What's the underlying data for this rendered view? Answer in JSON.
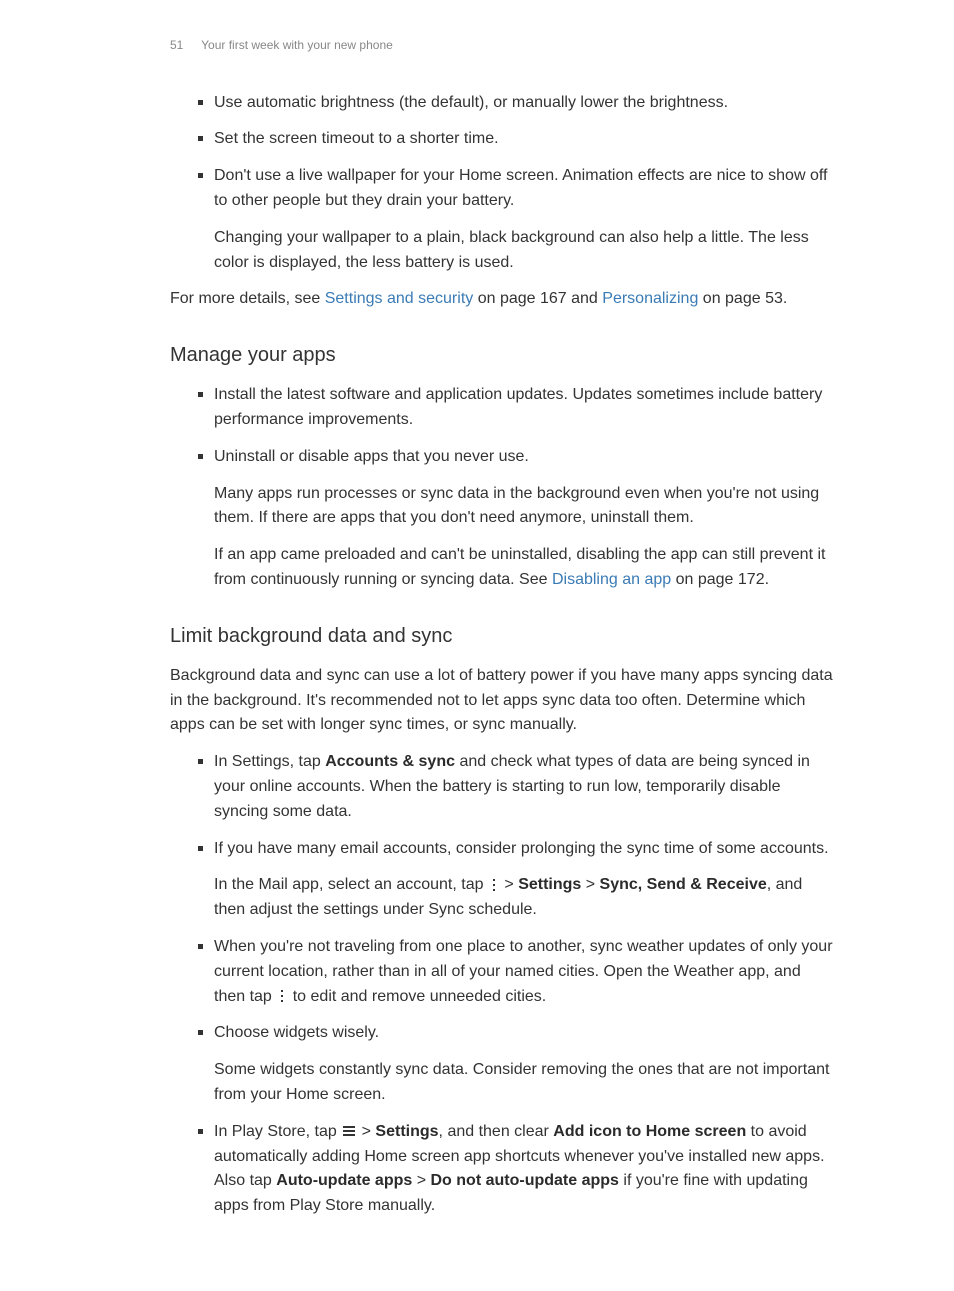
{
  "header": {
    "page_number": "51",
    "breadcrumb": "Your first week with your new phone"
  },
  "section1": {
    "b1": "Use automatic brightness (the default), or manually lower the brightness.",
    "b2": "Set the screen timeout to a shorter time.",
    "b3": "Don't use a live wallpaper for your Home screen. Animation effects are nice to show off to other people but they drain your battery.",
    "b3_sub": "Changing your wallpaper to a plain, black background can also help a little. The less color is displayed, the less battery is used.",
    "footer_pre": "For more details, see ",
    "footer_link1": "Settings and security",
    "footer_mid": " on page 167 and ",
    "footer_link2": "Personalizing",
    "footer_post": " on page 53."
  },
  "section2": {
    "title": "Manage your apps",
    "b1": "Install the latest software and application updates. Updates sometimes include battery performance improvements.",
    "b2": "Uninstall or disable apps that you never use.",
    "b2_sub1": "Many apps run processes or sync data in the background even when you're not using them. If there are apps that you don't need anymore, uninstall them.",
    "b2_sub2_pre": "If an app came preloaded and can't be uninstalled, disabling the app can still prevent it from continuously running or syncing data. See ",
    "b2_sub2_link": "Disabling an app",
    "b2_sub2_post": " on page 172."
  },
  "section3": {
    "title": "Limit background data and sync",
    "intro": "Background data and sync can use a lot of battery power if you have many apps syncing data in the background. It's recommended not to let apps sync data too often. Determine which apps can be set with longer sync times, or sync manually.",
    "b1_pre": "In Settings, tap ",
    "b1_bold": "Accounts & sync",
    "b1_post": " and check what types of data are being synced in your online accounts. When the battery is starting to run low, temporarily disable syncing some data.",
    "b2": "If you have many email accounts, consider prolonging the sync time of some accounts.",
    "b2_sub_pre": "In the Mail app, select an account, tap ",
    "b2_sub_mid1": " > ",
    "b2_sub_bold1": "Settings",
    "b2_sub_mid2": " > ",
    "b2_sub_bold2": "Sync, Send & Receive",
    "b2_sub_post": ", and then adjust the settings under Sync schedule.",
    "b3_pre": "When you're not traveling from one place to another, sync weather updates of only your current location, rather than in all of your named cities. Open the Weather app, and then tap ",
    "b3_post": " to edit and remove unneeded cities.",
    "b4": "Choose widgets wisely.",
    "b4_sub": "Some widgets constantly sync data. Consider removing the ones that are not important from your Home screen.",
    "b5_pre": "In Play Store, tap ",
    "b5_mid1": "  > ",
    "b5_bold1": "Settings",
    "b5_mid2": ", and then clear ",
    "b5_bold2": "Add icon to Home screen",
    "b5_mid3": " to avoid automatically adding Home screen app shortcuts whenever you've installed new apps. Also tap ",
    "b5_bold3": "Auto-update apps",
    "b5_mid4": " > ",
    "b5_bold4": "Do not auto-update apps",
    "b5_post": " if you're fine with updating apps from Play Store manually."
  }
}
